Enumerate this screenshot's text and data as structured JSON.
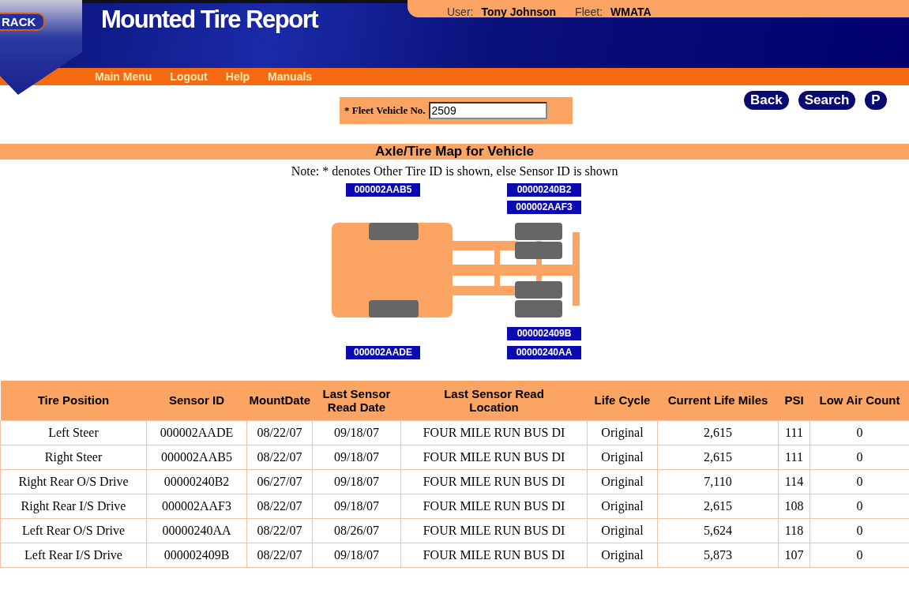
{
  "header": {
    "logo_text": "RACK",
    "title": "Mounted Tire Report",
    "user_label": "User:",
    "user": "Tony Johnson",
    "fleet_label": "Fleet:",
    "fleet": "WMATA"
  },
  "nav": [
    "Main Menu",
    "Logout",
    "Help",
    "Manuals"
  ],
  "vehicle_field": {
    "label": "* Fleet Vehicle No.",
    "value": "2509"
  },
  "buttons": [
    "Back",
    "Search",
    "P"
  ],
  "section_title": "Axle/Tire Map for Vehicle",
  "note": "Note: * denotes Other Tire ID is shown, else Sensor ID is shown",
  "tire_map": {
    "tags": [
      {
        "text": "000002AAB5",
        "kind": "fronttop"
      },
      {
        "text": "00000240B2",
        "kind": "reartopouter"
      },
      {
        "text": "000002AAF3",
        "kind": "reartopinner"
      },
      {
        "text": "000002409B",
        "kind": "rearbottominner"
      },
      {
        "text": "000002AADE",
        "kind": "frontbottom"
      },
      {
        "text": "00000240AA",
        "kind": "rearbottomouter"
      }
    ]
  },
  "table": {
    "columns": [
      "Tire Position",
      "Sensor ID",
      "MountDate",
      "Last Sensor Read Date",
      "Last Sensor Read Location",
      "Life Cycle",
      "Current Life Miles",
      "PSI",
      "Low Air Count"
    ],
    "rows": [
      [
        "Left Steer",
        "000002AADE",
        "08/22/07",
        "09/18/07",
        "FOUR MILE RUN BUS DI",
        "Original",
        "2,615",
        "111",
        "0"
      ],
      [
        "Right Steer",
        "000002AAB5",
        "08/22/07",
        "09/18/07",
        "FOUR MILE RUN BUS DI",
        "Original",
        "2,615",
        "111",
        "0"
      ],
      [
        "Right Rear O/S Drive",
        "00000240B2",
        "06/27/07",
        "09/18/07",
        "FOUR MILE RUN BUS DI",
        "Original",
        "7,110",
        "114",
        "0"
      ],
      [
        "Right Rear I/S Drive",
        "000002AAF3",
        "08/22/07",
        "09/18/07",
        "FOUR MILE RUN BUS DI",
        "Original",
        "2,615",
        "108",
        "0"
      ],
      [
        "Left Rear O/S Drive",
        "00000240AA",
        "08/22/07",
        "08/26/07",
        "FOUR MILE RUN BUS DI",
        "Original",
        "5,624",
        "118",
        "0"
      ],
      [
        "Left Rear I/S Drive",
        "000002409B",
        "08/22/07",
        "09/18/07",
        "FOUR MILE RUN BUS DI",
        "Original",
        "5,873",
        "107",
        "0"
      ]
    ]
  }
}
